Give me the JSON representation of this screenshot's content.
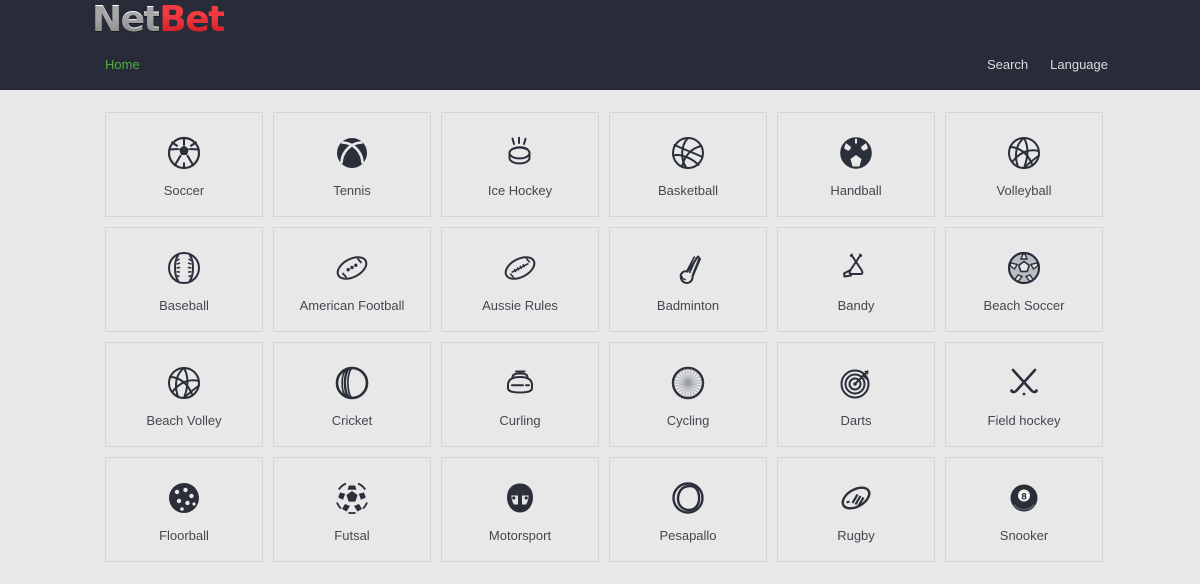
{
  "header": {
    "logo": {
      "part1": "Net",
      "part2": "Bet",
      "color1": "#ffffff",
      "color2": "#e8212b"
    },
    "background_color": "#282c38",
    "nav_left": [
      {
        "label": "Home",
        "color": "#4caf3f"
      }
    ],
    "nav_right": [
      {
        "label": "Search"
      },
      {
        "label": "Language"
      }
    ]
  },
  "page": {
    "background_color": "#e9e9e9",
    "tile_background_color": "#e8e8e8",
    "tile_border_color": "#d4d4d4",
    "icon_color": "#2b2f3a",
    "label_color": "#43474f"
  },
  "sports_grid": {
    "columns": 6,
    "items": [
      {
        "label": "Soccer",
        "icon": "soccer-ball-icon"
      },
      {
        "label": "Tennis",
        "icon": "tennis-ball-icon"
      },
      {
        "label": "Ice Hockey",
        "icon": "hockey-puck-icon"
      },
      {
        "label": "Basketball",
        "icon": "basketball-icon"
      },
      {
        "label": "Handball",
        "icon": "handball-icon"
      },
      {
        "label": "Volleyball",
        "icon": "volleyball-icon"
      },
      {
        "label": "Baseball",
        "icon": "baseball-icon"
      },
      {
        "label": "American Football",
        "icon": "american-football-icon"
      },
      {
        "label": "Aussie Rules",
        "icon": "aussie-rules-ball-icon"
      },
      {
        "label": "Badminton",
        "icon": "badminton-shuttlecock-icon"
      },
      {
        "label": "Bandy",
        "icon": "bandy-sticks-icon"
      },
      {
        "label": "Beach Soccer",
        "icon": "beach-soccer-ball-icon"
      },
      {
        "label": "Beach Volley",
        "icon": "beach-volleyball-icon"
      },
      {
        "label": "Cricket",
        "icon": "cricket-ball-icon"
      },
      {
        "label": "Curling",
        "icon": "curling-stone-icon"
      },
      {
        "label": "Cycling",
        "icon": "bicycle-wheel-icon"
      },
      {
        "label": "Darts",
        "icon": "dartboard-icon"
      },
      {
        "label": "Field hockey",
        "icon": "field-hockey-sticks-icon"
      },
      {
        "label": "Floorball",
        "icon": "floorball-ball-icon"
      },
      {
        "label": "Futsal",
        "icon": "futsal-ball-icon"
      },
      {
        "label": "Motorsport",
        "icon": "racing-helmet-icon"
      },
      {
        "label": "Pesapallo",
        "icon": "pesapallo-ball-icon"
      },
      {
        "label": "Rugby",
        "icon": "rugby-ball-icon"
      },
      {
        "label": "Snooker",
        "icon": "snooker-eight-ball-icon"
      }
    ]
  }
}
